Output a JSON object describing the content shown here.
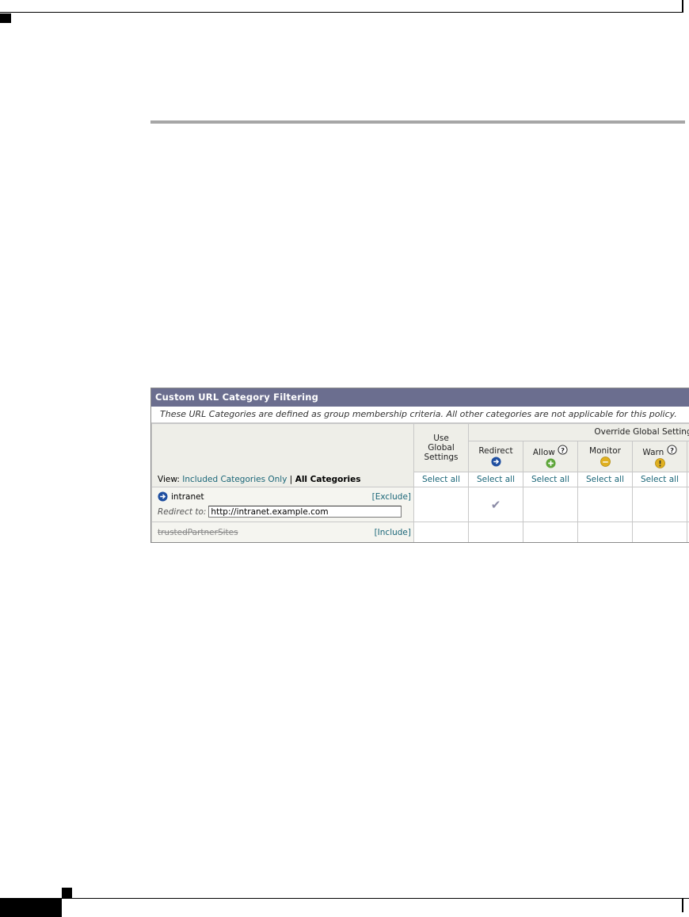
{
  "panel": {
    "title": "Custom URL Category Filtering",
    "description": "These URL Categories are defined as group membership criteria. All other categories are not applicable for this policy.",
    "view": {
      "label": "View:",
      "included_only": "Included Categories Only",
      "separator": "|",
      "all_categories": "All Categories"
    },
    "global_settings_header": [
      "Use",
      "Global",
      "Settings"
    ],
    "override_label": "Override Global Settings",
    "columns": [
      {
        "name": "Redirect",
        "help": false,
        "icon": "redirect-arrow-icon",
        "color": "#1f4fa0"
      },
      {
        "name": "Allow",
        "help": true,
        "icon": "allow-plus-icon",
        "color": "#5ea63a"
      },
      {
        "name": "Monitor",
        "help": false,
        "icon": "monitor-circle-icon",
        "color": "#e0b020"
      },
      {
        "name": "Warn",
        "help": true,
        "icon": "warn-exclamation-icon",
        "color": "#e0b020"
      }
    ],
    "select_all": "Select all",
    "help_glyph": "?",
    "rows": [
      {
        "name": "intranet",
        "action_link": "[Exclude]",
        "redirect_label": "Redirect to:",
        "redirect_value": "http://intranet.example.com",
        "selected_column": "Redirect",
        "check_glyph": "✔"
      },
      {
        "name": "trustedPartnerSites",
        "action_link": "[Include]",
        "excluded": true
      }
    ]
  }
}
